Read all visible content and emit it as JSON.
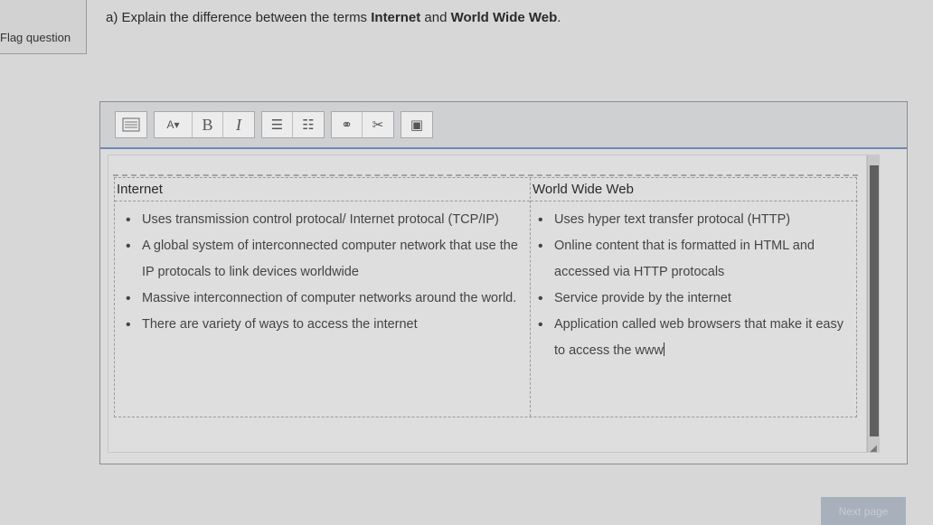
{
  "left": {
    "flag_label": "Flag question"
  },
  "question": {
    "prefix": "a) Explain the difference between the terms ",
    "term1": "Internet",
    "middle": " and ",
    "term2": "World Wide Web",
    "suffix": "."
  },
  "toolbar": {
    "items": [
      {
        "name": "toolbar-toggle-icon"
      },
      {
        "name": "font-size-icon",
        "label": "A▾"
      },
      {
        "name": "bold-icon",
        "label": "B"
      },
      {
        "name": "italic-icon",
        "label": "I"
      },
      {
        "name": "unordered-list-icon",
        "label": "☰"
      },
      {
        "name": "ordered-list-icon",
        "label": "☷"
      },
      {
        "name": "link-icon",
        "label": "⚭"
      },
      {
        "name": "unlink-icon",
        "label": "✂"
      },
      {
        "name": "image-icon",
        "label": "▣"
      }
    ]
  },
  "table": {
    "internet": {
      "header": "Internet",
      "items": [
        "Uses transmission control protocal/ Internet protocal (TCP/IP)",
        "A global system of interconnected computer network that use the IP protocals to link devices worldwide",
        "Massive interconnection of computer networks around the world.",
        "There are variety of ways to access the internet"
      ]
    },
    "www": {
      "header": "World Wide Web",
      "items": [
        "Uses hyper text transfer protocal (HTTP)",
        "Online content that is formatted in HTML and accessed via HTTP protocals",
        "Service provide by the internet",
        "Application called web browsers that make it easy to access the www"
      ]
    }
  },
  "navigation": {
    "next_label": "Next page"
  }
}
